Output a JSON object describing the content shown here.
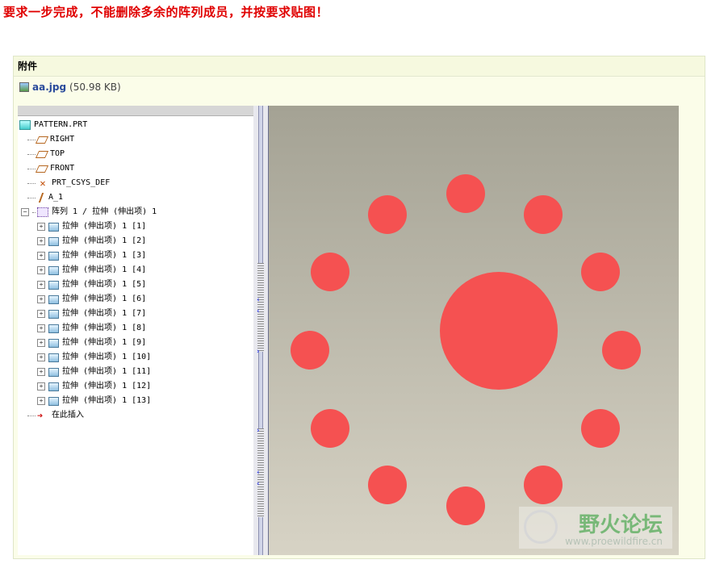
{
  "headline": "要求一步完成，不能删除多余的阵列成员，并按要求贴图！",
  "attachment": {
    "header": "附件",
    "file_name": "aa.jpg",
    "file_size": "(50.98 KB)"
  },
  "model_tree": {
    "items": [
      {
        "label": "PATTERN.PRT",
        "icon": "part-icon"
      },
      {
        "label": "RIGHT",
        "icon": "datum-plane-icon"
      },
      {
        "label": "TOP",
        "icon": "datum-plane-icon"
      },
      {
        "label": "FRONT",
        "icon": "datum-plane-icon"
      },
      {
        "label": "PRT_CSYS_DEF",
        "icon": "csys-icon"
      },
      {
        "label": "A_1",
        "icon": "axis-icon"
      },
      {
        "label": "阵列 1 / 拉伸 (伸出项) 1",
        "icon": "pattern-icon"
      },
      {
        "label": "拉伸 (伸出项) 1 [1]",
        "icon": "extrude-icon"
      },
      {
        "label": "拉伸 (伸出项) 1 [2]",
        "icon": "extrude-icon"
      },
      {
        "label": "拉伸 (伸出项) 1 [3]",
        "icon": "extrude-icon"
      },
      {
        "label": "拉伸 (伸出项) 1 [4]",
        "icon": "extrude-icon"
      },
      {
        "label": "拉伸 (伸出项) 1 [5]",
        "icon": "extrude-icon"
      },
      {
        "label": "拉伸 (伸出项) 1 [6]",
        "icon": "extrude-icon"
      },
      {
        "label": "拉伸 (伸出项) 1 [7]",
        "icon": "extrude-icon"
      },
      {
        "label": "拉伸 (伸出项) 1 [8]",
        "icon": "extrude-icon"
      },
      {
        "label": "拉伸 (伸出项) 1 [9]",
        "icon": "extrude-icon"
      },
      {
        "label": "拉伸 (伸出项) 1 [10]",
        "icon": "extrude-icon"
      },
      {
        "label": "拉伸 (伸出项) 1 [11]",
        "icon": "extrude-icon"
      },
      {
        "label": "拉伸 (伸出项) 1 [12]",
        "icon": "extrude-icon"
      },
      {
        "label": "拉伸 (伸出项) 1 [13]",
        "icon": "extrude-icon"
      },
      {
        "label": "在此插入",
        "icon": "insert-here-icon"
      }
    ]
  },
  "viewport": {
    "circle_color": "#f55151",
    "background_top": "#a4a294",
    "background_bottom": "#d7d3c5"
  },
  "watermark": {
    "text": "野火论坛",
    "url": "www.proewildfire.cn"
  }
}
